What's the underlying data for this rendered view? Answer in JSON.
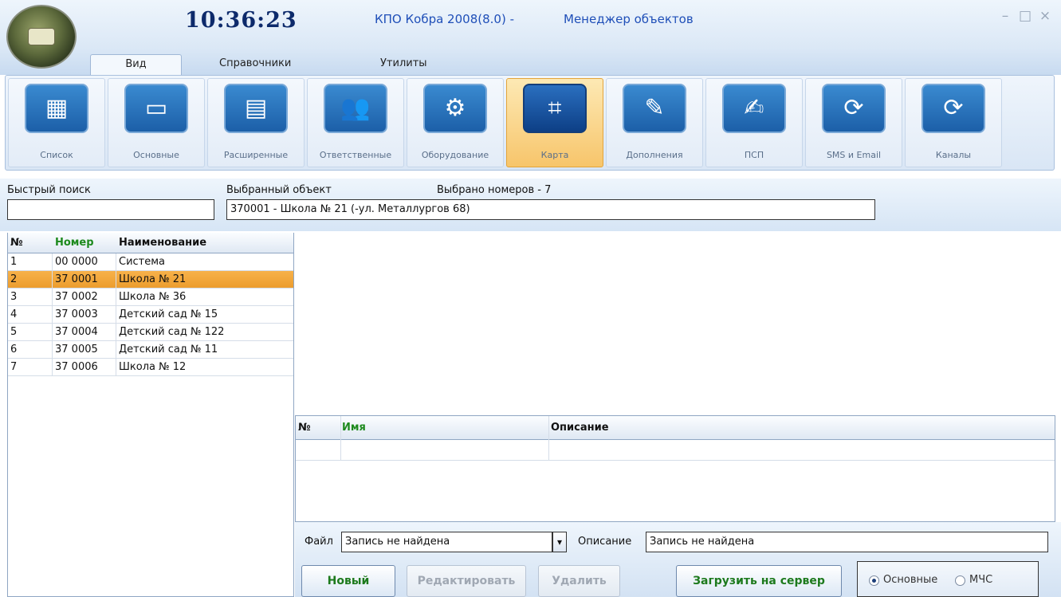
{
  "titlebar": {
    "clock": "10:36:23",
    "app_name": "КПО Кобра 2008(8.0) -",
    "window_title": "Менеджер объектов",
    "min_icon": "–",
    "max_icon": "□",
    "close_icon": "×"
  },
  "tabs": [
    "Вид",
    "Справочники",
    "Утилиты"
  ],
  "ribbon": [
    {
      "label": "Список",
      "icon": "▦"
    },
    {
      "label": "Основные",
      "icon": "▭"
    },
    {
      "label": "Расширенные",
      "icon": "▤"
    },
    {
      "label": "Ответственные",
      "icon": "👥"
    },
    {
      "label": "Оборудование",
      "icon": "⚙"
    },
    {
      "label": "Карта",
      "icon": "⌗"
    },
    {
      "label": "Дополнения",
      "icon": "✎"
    },
    {
      "label": "ПСП",
      "icon": "✍"
    },
    {
      "label": "SMS и Email",
      "icon": "⟳"
    },
    {
      "label": "Каналы",
      "icon": "⟳"
    }
  ],
  "search": {
    "quick_label": "Быстрый поиск",
    "quick_value": "",
    "selected_label": "Выбранный объект",
    "selected_count_label": "Выбрано номеров - 7",
    "selected_value": "370001 - Школа № 21 (-ул. Металлургов 68)"
  },
  "objects_table": {
    "headers": {
      "num": "№",
      "number": "Номер",
      "name": "Наименование"
    },
    "rows": [
      {
        "num": "1",
        "number": "00 0000",
        "name": "Система"
      },
      {
        "num": "2",
        "number": "37 0001",
        "name": "Школа № 21"
      },
      {
        "num": "3",
        "number": "37 0002",
        "name": "Школа № 36"
      },
      {
        "num": "4",
        "number": "37 0003",
        "name": "Детский сад № 15"
      },
      {
        "num": "5",
        "number": "37 0004",
        "name": "Детский сад № 122"
      },
      {
        "num": "6",
        "number": "37 0005",
        "name": "Детский сад № 11"
      },
      {
        "num": "7",
        "number": "37 0006",
        "name": "Школа № 12"
      }
    ],
    "selected_index": 1
  },
  "files_table": {
    "headers": {
      "num": "№",
      "name": "Имя",
      "description": "Описание"
    }
  },
  "bottom": {
    "file_label": "Файл",
    "file_value": "Запись не найдена",
    "dropdown_icon": "▾",
    "description_label": "Описание",
    "description_value": "Запись не найдена",
    "new_button": "Новый",
    "edit_button": "Редактировать",
    "delete_button": "Удалить",
    "upload_button": "Загрузить на сервер",
    "radio_main": "Основные",
    "radio_mchs": "МЧС"
  },
  "colors": {
    "accent_blue": "#1f4fb8",
    "selected_row": "#f7b24a",
    "header_green": "#1d8a1d"
  }
}
